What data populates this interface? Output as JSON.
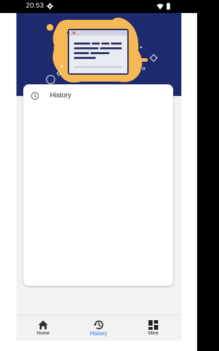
{
  "status_bar": {
    "time": "20:53",
    "icons": [
      "gear-icon",
      "wifi-icon",
      "battery-icon"
    ]
  },
  "colors": {
    "hero_background": "#1f2a6e",
    "hero_accent": "#f7b955",
    "active_tab": "#2f6fd6"
  },
  "card": {
    "items": [
      {
        "icon": "history-icon",
        "label": "History"
      }
    ]
  },
  "bottom_nav": {
    "items": [
      {
        "icon": "home-icon",
        "label": "Home",
        "active": false
      },
      {
        "icon": "history-icon",
        "label": "History",
        "active": true
      },
      {
        "icon": "grid-icon",
        "label": "Mine",
        "active": false
      }
    ]
  }
}
